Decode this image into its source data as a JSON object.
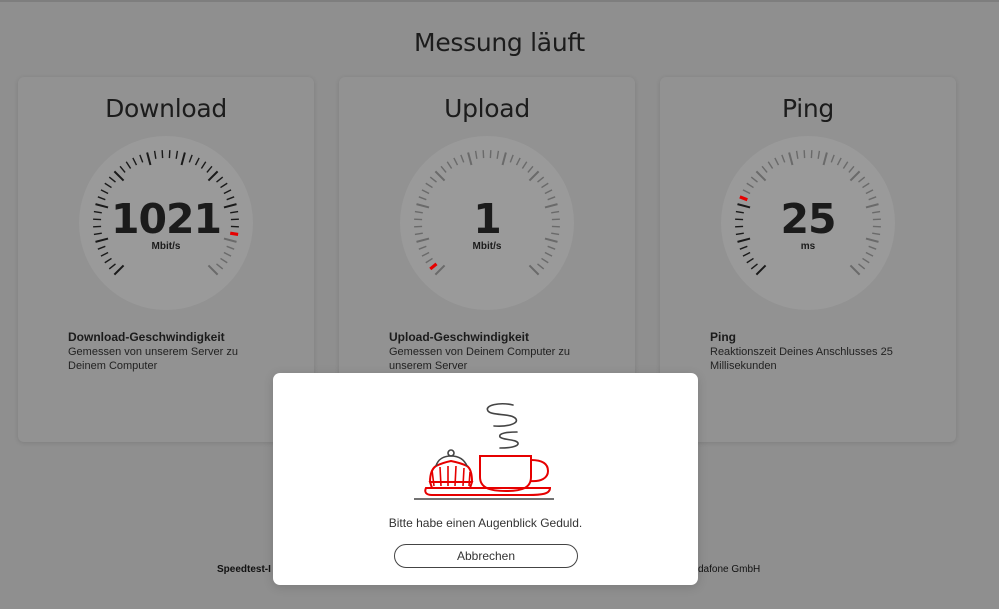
{
  "page": {
    "title": "Messung läuft"
  },
  "cards": [
    {
      "title": "Download",
      "value": "1021",
      "unit": "Mbit/s",
      "subtitle": "Download-Geschwindigkeit",
      "description": "Gemessen von unserem Server zu Deinem Computer",
      "gauge_fraction": 0.86,
      "filled": true
    },
    {
      "title": "Upload",
      "value": "1",
      "unit": "Mbit/s",
      "subtitle": "Upload-Geschwindigkeit",
      "description": "Gemessen von Deinem Computer zu unserem Server",
      "gauge_fraction": 0.02,
      "filled": false
    },
    {
      "title": "Ping",
      "value": "25",
      "unit": "ms",
      "subtitle": "Ping",
      "description": "Reaktionszeit Deines Anschlusses 25 Millisekunden",
      "gauge_fraction": 0.25,
      "filled": true
    }
  ],
  "footer": {
    "left": "Speedtest-I",
    "right": "dafone GmbH"
  },
  "modal": {
    "message": "Bitte habe einen Augenblick Geduld.",
    "cancel_label": "Abbrechen",
    "icon": "coffee-cupcake-illustration"
  },
  "colors": {
    "accent": "#e60000",
    "tick_dark": "#1a1a1a",
    "tick_light": "#6a6a6a"
  }
}
